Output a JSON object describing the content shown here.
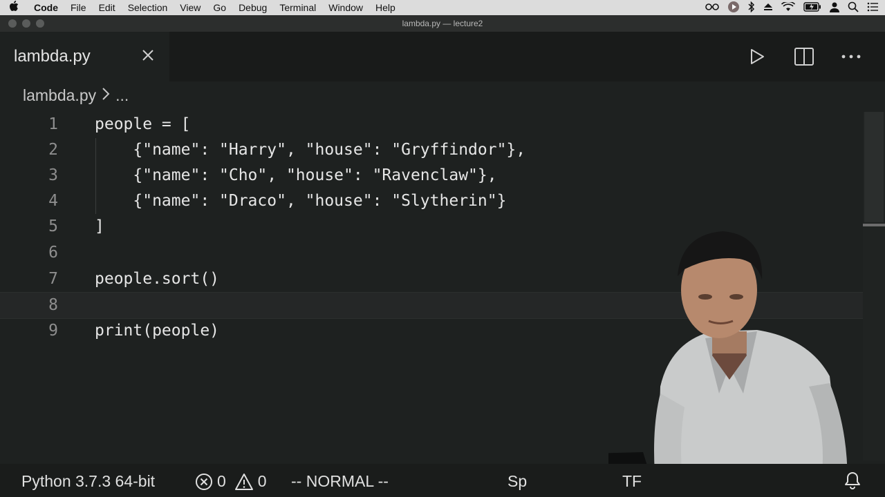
{
  "menubar": {
    "app": "Code",
    "items": [
      "File",
      "Edit",
      "Selection",
      "View",
      "Go",
      "Debug",
      "Terminal",
      "Window",
      "Help"
    ]
  },
  "window": {
    "title": "lambda.py — lecture2"
  },
  "tab": {
    "label": "lambda.py"
  },
  "breadcrumb": {
    "file": "lambda.py",
    "more": "..."
  },
  "editor": {
    "lines": [
      {
        "n": "1",
        "text": "people = ["
      },
      {
        "n": "2",
        "text": "    {\"name\": \"Harry\", \"house\": \"Gryffindor\"},"
      },
      {
        "n": "3",
        "text": "    {\"name\": \"Cho\", \"house\": \"Ravenclaw\"},"
      },
      {
        "n": "4",
        "text": "    {\"name\": \"Draco\", \"house\": \"Slytherin\"}"
      },
      {
        "n": "5",
        "text": "]"
      },
      {
        "n": "6",
        "text": ""
      },
      {
        "n": "7",
        "text": "people.sort()"
      },
      {
        "n": "8",
        "text": ""
      },
      {
        "n": "9",
        "text": "print(people)"
      }
    ],
    "current_line": "8"
  },
  "statusbar": {
    "interpreter": "Python 3.7.3 64-bit",
    "errors": "0",
    "warnings": "0",
    "vim_mode": "-- NORMAL --",
    "spaces_partial": "Sp",
    "encoding_partial": "TF"
  },
  "colors": {
    "background": "#1e2120",
    "text": "#e6e6e6",
    "line_number": "#8e8e8e"
  }
}
